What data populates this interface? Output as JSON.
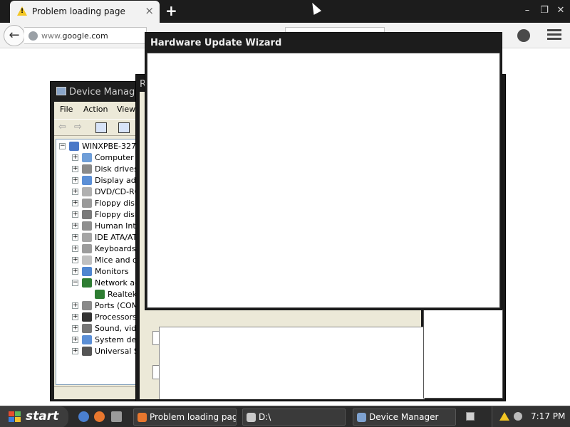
{
  "browser": {
    "tab_title": "Problem loading page",
    "tab_close": "×",
    "new_tab": "+",
    "url_prefix": "www.",
    "url_domain": "google.com",
    "window_controls": [
      "–",
      "❐",
      "✕"
    ]
  },
  "device_manager": {
    "title": "Device Manager",
    "menu": [
      "File",
      "Action",
      "View"
    ],
    "tree": [
      {
        "label": "WINXPBE-327",
        "expander": "−",
        "level": 0,
        "icon_color": "#4a78c8"
      },
      {
        "label": "Computer",
        "expander": "+",
        "level": 1,
        "icon_color": "#6f9ed8"
      },
      {
        "label": "Disk drives",
        "expander": "+",
        "level": 1,
        "icon_color": "#8a8a8a"
      },
      {
        "label": "Display ada",
        "expander": "+",
        "level": 1,
        "icon_color": "#5b8fd6"
      },
      {
        "label": "DVD/CD-RO",
        "expander": "+",
        "level": 1,
        "icon_color": "#b0b0b0"
      },
      {
        "label": "Floppy disk",
        "expander": "+",
        "level": 1,
        "icon_color": "#9a9a9a"
      },
      {
        "label": "Floppy disk",
        "expander": "+",
        "level": 1,
        "icon_color": "#7a7a7a"
      },
      {
        "label": "Human Inte",
        "expander": "+",
        "level": 1,
        "icon_color": "#8f8f8f"
      },
      {
        "label": "IDE ATA/AT",
        "expander": "+",
        "level": 1,
        "icon_color": "#a5a5a5"
      },
      {
        "label": "Keyboards",
        "expander": "+",
        "level": 1,
        "icon_color": "#9c9c9c"
      },
      {
        "label": "Mice and ot",
        "expander": "+",
        "level": 1,
        "icon_color": "#c0c0c0"
      },
      {
        "label": "Monitors",
        "expander": "+",
        "level": 1,
        "icon_color": "#4f86d0"
      },
      {
        "label": "Network ad",
        "expander": "−",
        "level": 1,
        "icon_color": "#2e7d32"
      },
      {
        "label": "Realtek",
        "expander": "",
        "level": 2,
        "icon_color": "#2e7d32"
      },
      {
        "label": "Ports (COM",
        "expander": "+",
        "level": 1,
        "icon_color": "#8a8a8a"
      },
      {
        "label": "Processors",
        "expander": "+",
        "level": 1,
        "icon_color": "#333333"
      },
      {
        "label": "Sound, vide",
        "expander": "+",
        "level": 1,
        "icon_color": "#777777"
      },
      {
        "label": "System dev",
        "expander": "+",
        "level": 1,
        "icon_color": "#5b8fd6"
      },
      {
        "label": "Universal S",
        "expander": "+",
        "level": 1,
        "icon_color": "#555555"
      }
    ]
  },
  "background_dialog": {
    "title": "R"
  },
  "wizard": {
    "title": "Hardware Update Wizard"
  },
  "taskbar": {
    "start_label": "start",
    "tasks": [
      {
        "label": "Problem loading pag...",
        "icon_color": "#e8772e"
      },
      {
        "label": "D:\\",
        "icon_color": "#c9c9c9"
      },
      {
        "label": "Device Manager",
        "icon_color": "#7ea2d0"
      }
    ],
    "clock": "7:17 PM"
  },
  "colors": {
    "title_bar": "#1c1c1c",
    "window_face": "#ece9d8",
    "taskbar": "#2b2b2b",
    "warning": "#f3c623"
  }
}
